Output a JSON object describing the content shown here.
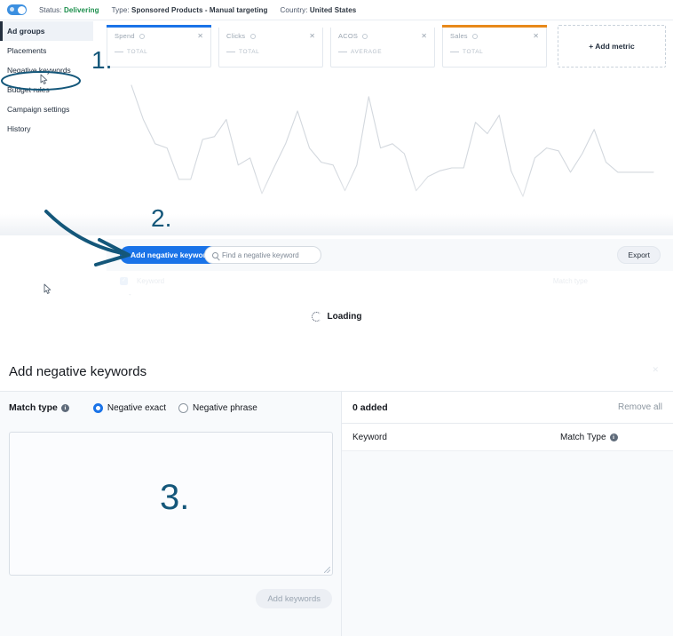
{
  "status_bar": {
    "toggle_state": "on",
    "items": [
      {
        "label": "Status:",
        "value": "Delivering",
        "value_color": "#1a8e4b"
      },
      {
        "label": "Type:",
        "value": "Sponsored Products - Manual targeting",
        "value_color": "#2c3540"
      },
      {
        "label": "Country:",
        "value": "United States",
        "value_color": "#2c3540"
      }
    ]
  },
  "sidebar": {
    "items": [
      {
        "label": "Ad groups"
      },
      {
        "label": "Placements"
      },
      {
        "label": "Negative keywords"
      },
      {
        "label": "Budget rules"
      },
      {
        "label": "Campaign settings"
      },
      {
        "label": "History"
      }
    ]
  },
  "metrics": {
    "cards": [
      {
        "name": "Spend",
        "sub": "TOTAL",
        "accent": "#1a73e8"
      },
      {
        "name": "Clicks",
        "sub": "TOTAL",
        "accent": "#ffffff"
      },
      {
        "name": "ACOS",
        "sub": "AVERAGE",
        "accent": "#ffffff"
      },
      {
        "name": "Sales",
        "sub": "TOTAL",
        "accent": "#e8891a"
      }
    ],
    "add_metric_label": "+ Add metric"
  },
  "chart_data": {
    "type": "line",
    "title": "",
    "xlabel": "",
    "ylabel": "",
    "grid": false,
    "legend": "none",
    "line_color": "#d3d8de",
    "x": [
      0,
      1,
      2,
      3,
      4,
      5,
      6,
      7,
      8,
      9,
      10,
      11,
      12,
      13,
      14,
      15,
      16,
      17,
      18,
      19,
      20,
      21,
      22,
      23,
      24,
      25,
      26,
      27,
      28,
      29,
      30,
      31,
      32,
      33,
      34,
      35,
      36,
      37,
      38,
      39,
      40,
      41,
      42,
      43,
      44
    ],
    "values": [
      96,
      72,
      55,
      52,
      30,
      30,
      58,
      60,
      72,
      40,
      45,
      20,
      38,
      55,
      78,
      52,
      42,
      40,
      22,
      40,
      88,
      52,
      55,
      48,
      22,
      32,
      36,
      38,
      38,
      70,
      62,
      75,
      36,
      18,
      45,
      52,
      50,
      35,
      48,
      65,
      42,
      35,
      35,
      35,
      35
    ]
  },
  "keywords_list": {
    "add_button_label": "Add negative keywords",
    "search_placeholder": "Find a negative keyword",
    "search_value": "",
    "export_label": "Export",
    "ghost_columns": [
      {
        "label": "Keyword"
      },
      {
        "label": "Match type"
      }
    ],
    "loading_label": "Loading"
  },
  "add_panel": {
    "title": "Add negative keywords",
    "match_type_label": "Match type",
    "options": [
      {
        "label": "Negative exact",
        "selected": true
      },
      {
        "label": "Negative phrase",
        "selected": false
      }
    ],
    "textarea_value": "",
    "add_keywords_label": "Add keywords",
    "added_count_label": "0 added",
    "remove_all_label": "Remove all",
    "columns": [
      {
        "label": "Keyword"
      },
      {
        "label": "Match Type"
      }
    ]
  },
  "annotations": {
    "step_one": "1.",
    "step_two": "2.",
    "step_three": "3.",
    "color": "#14577a"
  }
}
